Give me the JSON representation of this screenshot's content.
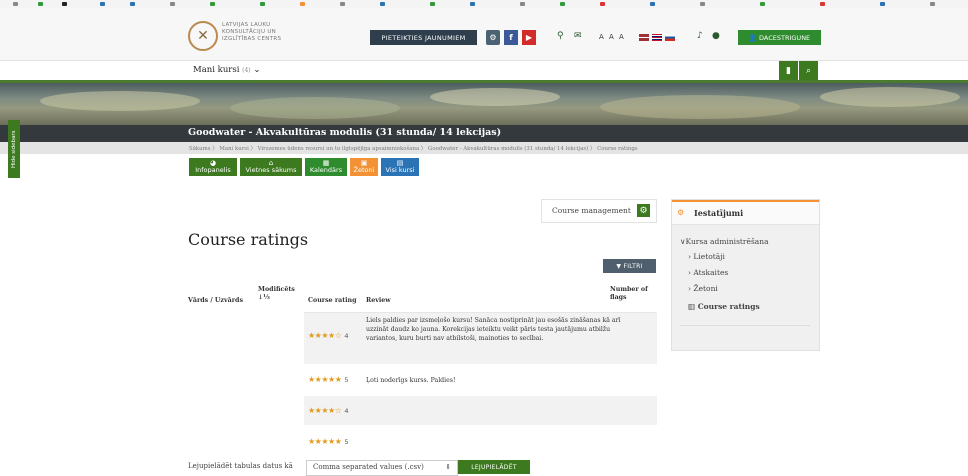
{
  "colors": {
    "brand_green": "#3d7a1f",
    "dark": "#33393d",
    "accent_orange": "#f39234",
    "star": "#e09a1c",
    "register_btn": "#2f3e4c",
    "user_btn": "#2e8b2e"
  },
  "header": {
    "logo_icon": "logo-emblem",
    "logo_lines": [
      "LATVIJAS LAUKU",
      "KONSULTĀCIJU UN",
      "IZGLĪTĪBAS CENTRS"
    ],
    "register_label": "PIETEIKTIES JAUNUMIEM",
    "social_icons": [
      "settings-circle-icon",
      "facebook-icon",
      "youtube-icon"
    ],
    "contact_icons": [
      "location-pin-icon",
      "mail-icon"
    ],
    "font_size_label": "A A A",
    "lang_flags": [
      "latvia-flag",
      "uk-flag",
      "russia-flag"
    ],
    "notification_icons": [
      "bell-icon",
      "chat-icon"
    ],
    "user_label": "DACESTRIGUNE"
  },
  "nav": {
    "my_courses_label": "Mani kursi",
    "my_courses_count": "(4)",
    "right_icons": [
      "bookmark-icon",
      "search-icon"
    ]
  },
  "sidebar_toggle": {
    "label": "Hide sidebars"
  },
  "course": {
    "title": "Goodwater - Akvakultūras modulis (31 stunda/ 14 lekcijas)",
    "breadcrumb": "Sākums  〉 Mani kursi  〉 Virszemes ūdens resursi un to ilgtspējīga apsaimniekošana  〉 Goodwater - Akvakultūras modulis (31 stunda/ 14 lekcijas)  〉 Course ratings"
  },
  "quick_links": [
    {
      "label": "Infopanelis",
      "icon": "dashboard-icon",
      "color": "#3d7a1f"
    },
    {
      "label": "Vietnes sākums",
      "icon": "home-icon",
      "color": "#3d7a1f"
    },
    {
      "label": "Kalendārs",
      "icon": "calendar-icon",
      "color": "#2e8b2e"
    },
    {
      "label": "Žetoni",
      "icon": "badge-icon",
      "color": "#f39234"
    },
    {
      "label": "Visi kursi",
      "icon": "courses-icon",
      "color": "#2a73b5"
    }
  ],
  "course_management_label": "Course management",
  "page_title": "Course ratings",
  "filter_label": "FILTRI",
  "table": {
    "headers": {
      "name": "Vārds / Uzvārds",
      "modified": "Modificēts",
      "course_rating": "Course rating",
      "review": "Review",
      "flags": "Number of flags"
    },
    "rows": [
      {
        "stars": "★★★★☆",
        "rating": "4",
        "review": "Liels paldies par izsmeļošo kursu! Sanāca nostiprināt jau esošās zināšanas kā arī uzzināt daudz ko jauna. Korekcijas ieteiktu veikt pāris testa jautājumu atbilžu variantos, kuru burti nav atbilstoši, mainoties to secībai."
      },
      {
        "stars": "★★★★★",
        "rating": "5",
        "review": "Ļoti noderīgs kurss. Paldies!"
      },
      {
        "stars": "★★★★☆",
        "rating": "4",
        "review": ""
      },
      {
        "stars": "★★★★★",
        "rating": "5",
        "review": ""
      }
    ]
  },
  "download": {
    "label": "Lejupielādēt tabulas datus kā",
    "format": "Comma separated values (.csv)",
    "button": "LEJUPIELĀDĒT"
  },
  "settings_block": {
    "title": "Iestatījumi",
    "section": "Kursa administrēšana",
    "items": [
      "Lietotāji",
      "Atskaites",
      "Žetoni"
    ],
    "active_item": "Course ratings"
  }
}
